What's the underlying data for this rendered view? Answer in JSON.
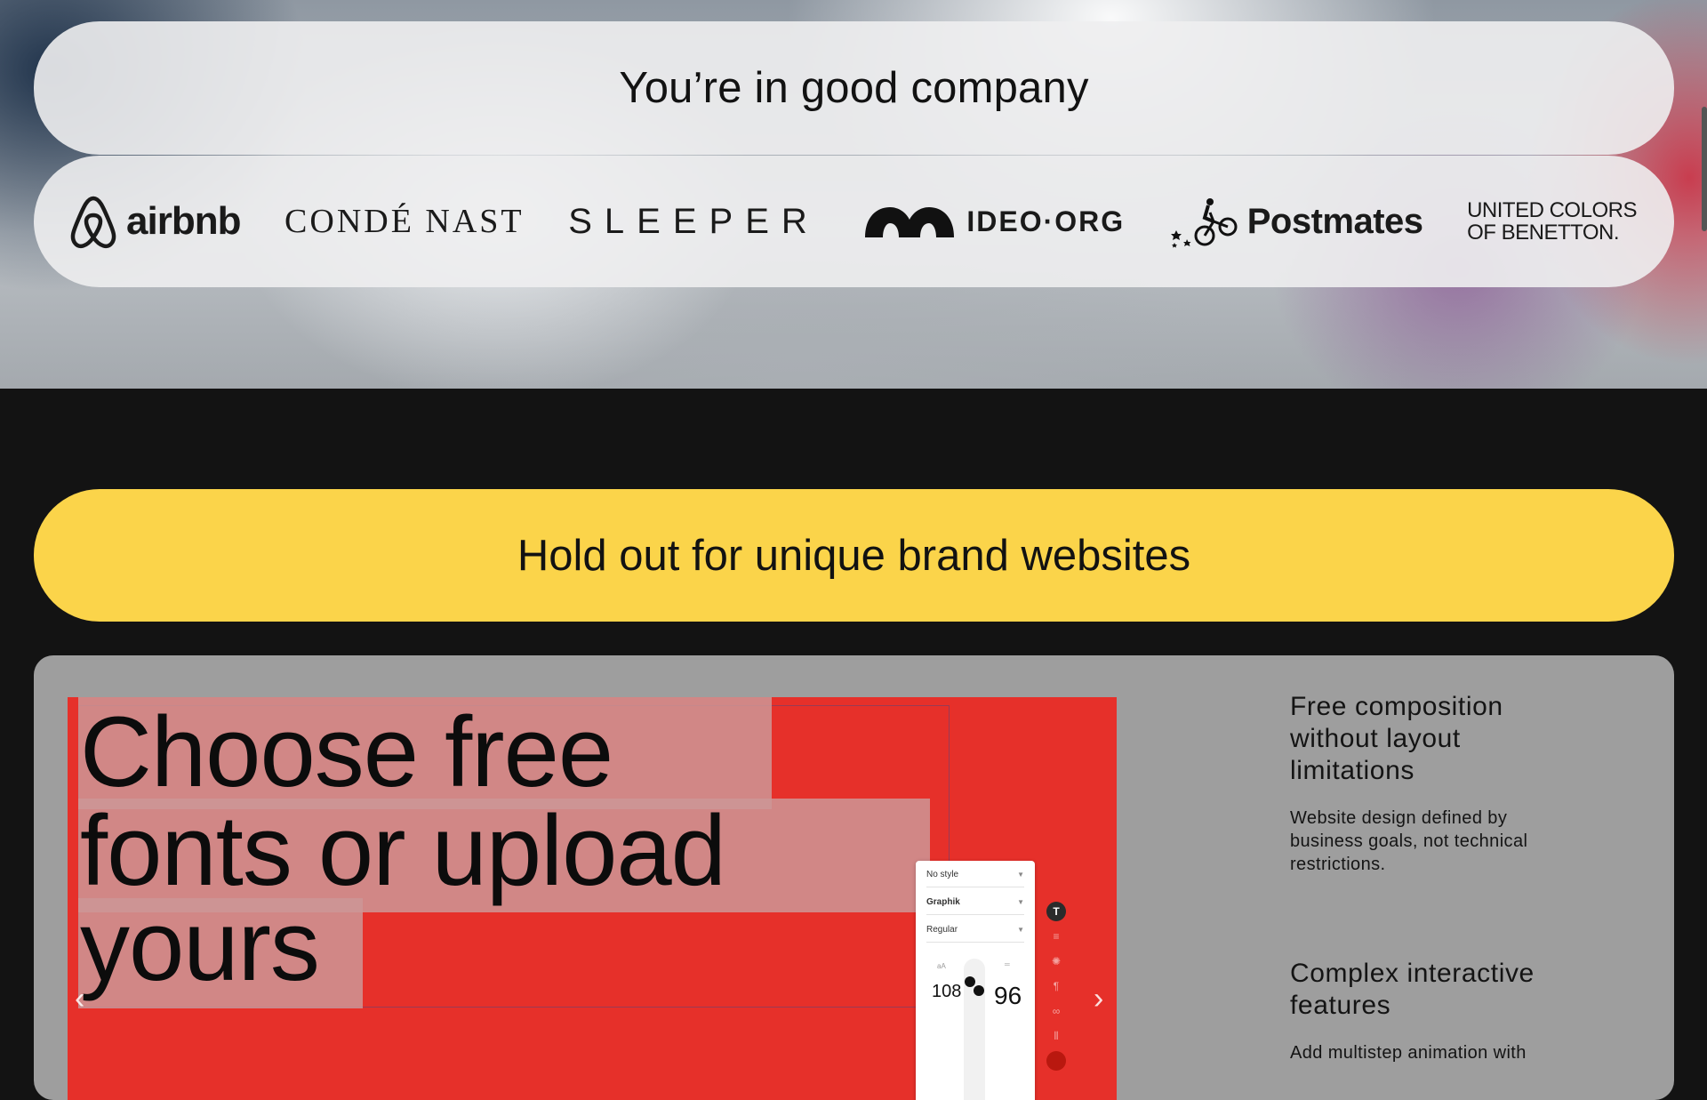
{
  "clients": {
    "title": "You’re in good company",
    "logos": [
      {
        "name": "airbnb",
        "text": "airbnb"
      },
      {
        "name": "conde-nast",
        "text": "CONDÉ NAST"
      },
      {
        "name": "sleeper",
        "text": "SLEEPER"
      },
      {
        "name": "ideo-org",
        "text": "IDEO·ORG"
      },
      {
        "name": "postmates",
        "text": "Postmates"
      },
      {
        "name": "benetton",
        "line1": "UNITED COLORS",
        "line2": "OF BENETTON."
      }
    ]
  },
  "banner": {
    "title": "Hold out for unique brand websites"
  },
  "demo": {
    "headline_lines": [
      "Choose free",
      "fonts or upload",
      "yours"
    ],
    "font_panel": {
      "style": "No style",
      "font": "Graphik",
      "weight": "Regular",
      "size_a": "108",
      "size_b": "96"
    }
  },
  "features": [
    {
      "title": "Free composition without layout limitations",
      "desc": "Website design defined by business goals, not technical restrictions."
    },
    {
      "title": "Complex interactive features",
      "desc": "Add multistep animation with"
    }
  ],
  "colors": {
    "yellow": "#fbd44a",
    "red": "#e6302a",
    "panel": "#9e9e9e",
    "dark": "#131313"
  }
}
